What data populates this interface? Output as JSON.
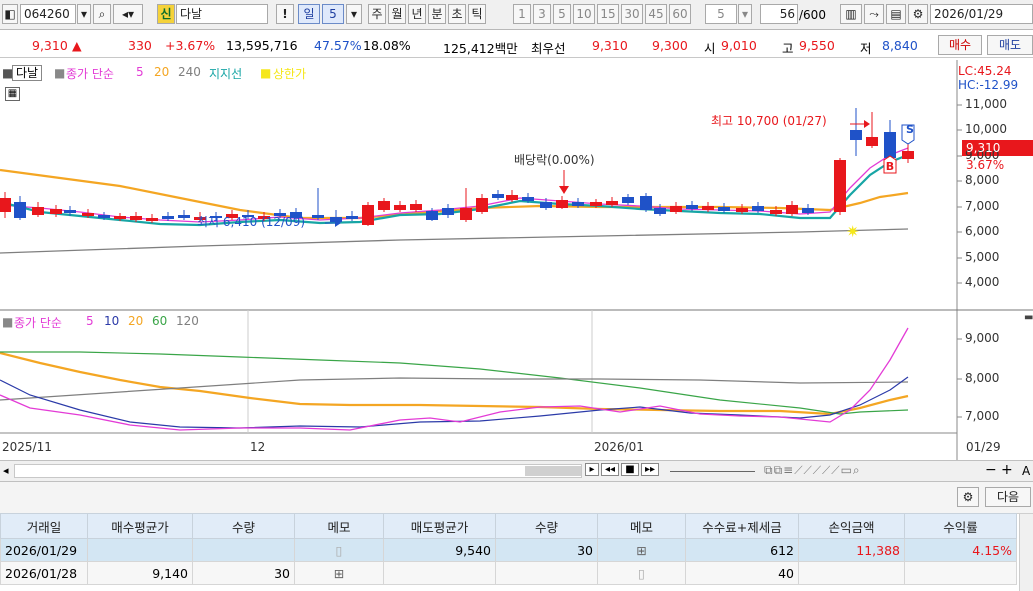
{
  "toolbar": {
    "code": "064260",
    "new_badge": "신",
    "stock_name": "다날",
    "period_selected": "일",
    "period_value": "5",
    "periods": [
      "주",
      "월",
      "년",
      "분",
      "초",
      "틱"
    ],
    "minutes": [
      "1",
      "3",
      "5",
      "10",
      "15",
      "30",
      "45",
      "60"
    ],
    "minute_value": "5",
    "count": "56",
    "count_total": "/600",
    "date": "2026/01/29"
  },
  "price_row": {
    "price": "9,310",
    "arrow": "▲",
    "change": "330",
    "change_pct": "+3.67%",
    "volume": "13,595,716",
    "vol_ratio": "47.57%",
    "turnover": "18.08%",
    "amount": "125,412백만",
    "best_quote_label": "최우선",
    "ask": "9,310",
    "bid": "9,300",
    "open_label": "시",
    "open": "9,010",
    "high_label": "고",
    "high": "9,550",
    "low_label": "저",
    "low": "8,840",
    "buy_label": "매수",
    "sell_label": "매도"
  },
  "price_chart": {
    "legend_name": "다날",
    "legend_ma": "종가 단순",
    "ma_periods": [
      "5",
      "20",
      "240"
    ],
    "support": "지지선",
    "upper_limit": "상한가",
    "max_label": "최고 10,700 (01/27)",
    "min_label": "최저 6,410 (12/09)",
    "dividend": "배당락(0.00%)",
    "lc": "LC:45.24",
    "hc": "HC:-12.99",
    "yticks": [
      "11,000",
      "10,000",
      "9,000",
      "8,000",
      "7,000",
      "6,000",
      "5,000",
      "4,000"
    ],
    "current_price": "9,310",
    "current_pct": "3.67%",
    "buy_marker": "B",
    "sell_marker": "S"
  },
  "volume_chart": {
    "legend_ma": "종가 단순",
    "ma_periods": [
      "5",
      "10",
      "20",
      "60",
      "120"
    ],
    "yticks": [
      "9,000",
      "8,000",
      "7,000"
    ]
  },
  "x_axis": {
    "labels": [
      "2025/11",
      "12",
      "2026/01"
    ],
    "right_label": "01/29"
  },
  "settings": {
    "next_label": "다음"
  },
  "trade_table": {
    "headers": [
      "거래일",
      "매수평균가",
      "수량",
      "메모",
      "매도평균가",
      "수량",
      "메모",
      "수수료+제세금",
      "손익금액",
      "수익률"
    ],
    "rows": [
      [
        "2026/01/29",
        "",
        "",
        "",
        "9,540",
        "30",
        "",
        "612",
        "11,388",
        "4.15%"
      ],
      [
        "2026/01/28",
        "9,140",
        "30",
        "",
        "",
        "",
        "",
        "40",
        "",
        ""
      ]
    ]
  },
  "colors": {
    "up": "#e8171c",
    "down": "#1f52c8",
    "ma5": "#e33bd6",
    "ma20": "#f4a623",
    "ma240": "#7f7f7f",
    "ma10": "#2b3aa8",
    "ma60": "#3aa548",
    "cur_box": "#e8171c"
  }
}
